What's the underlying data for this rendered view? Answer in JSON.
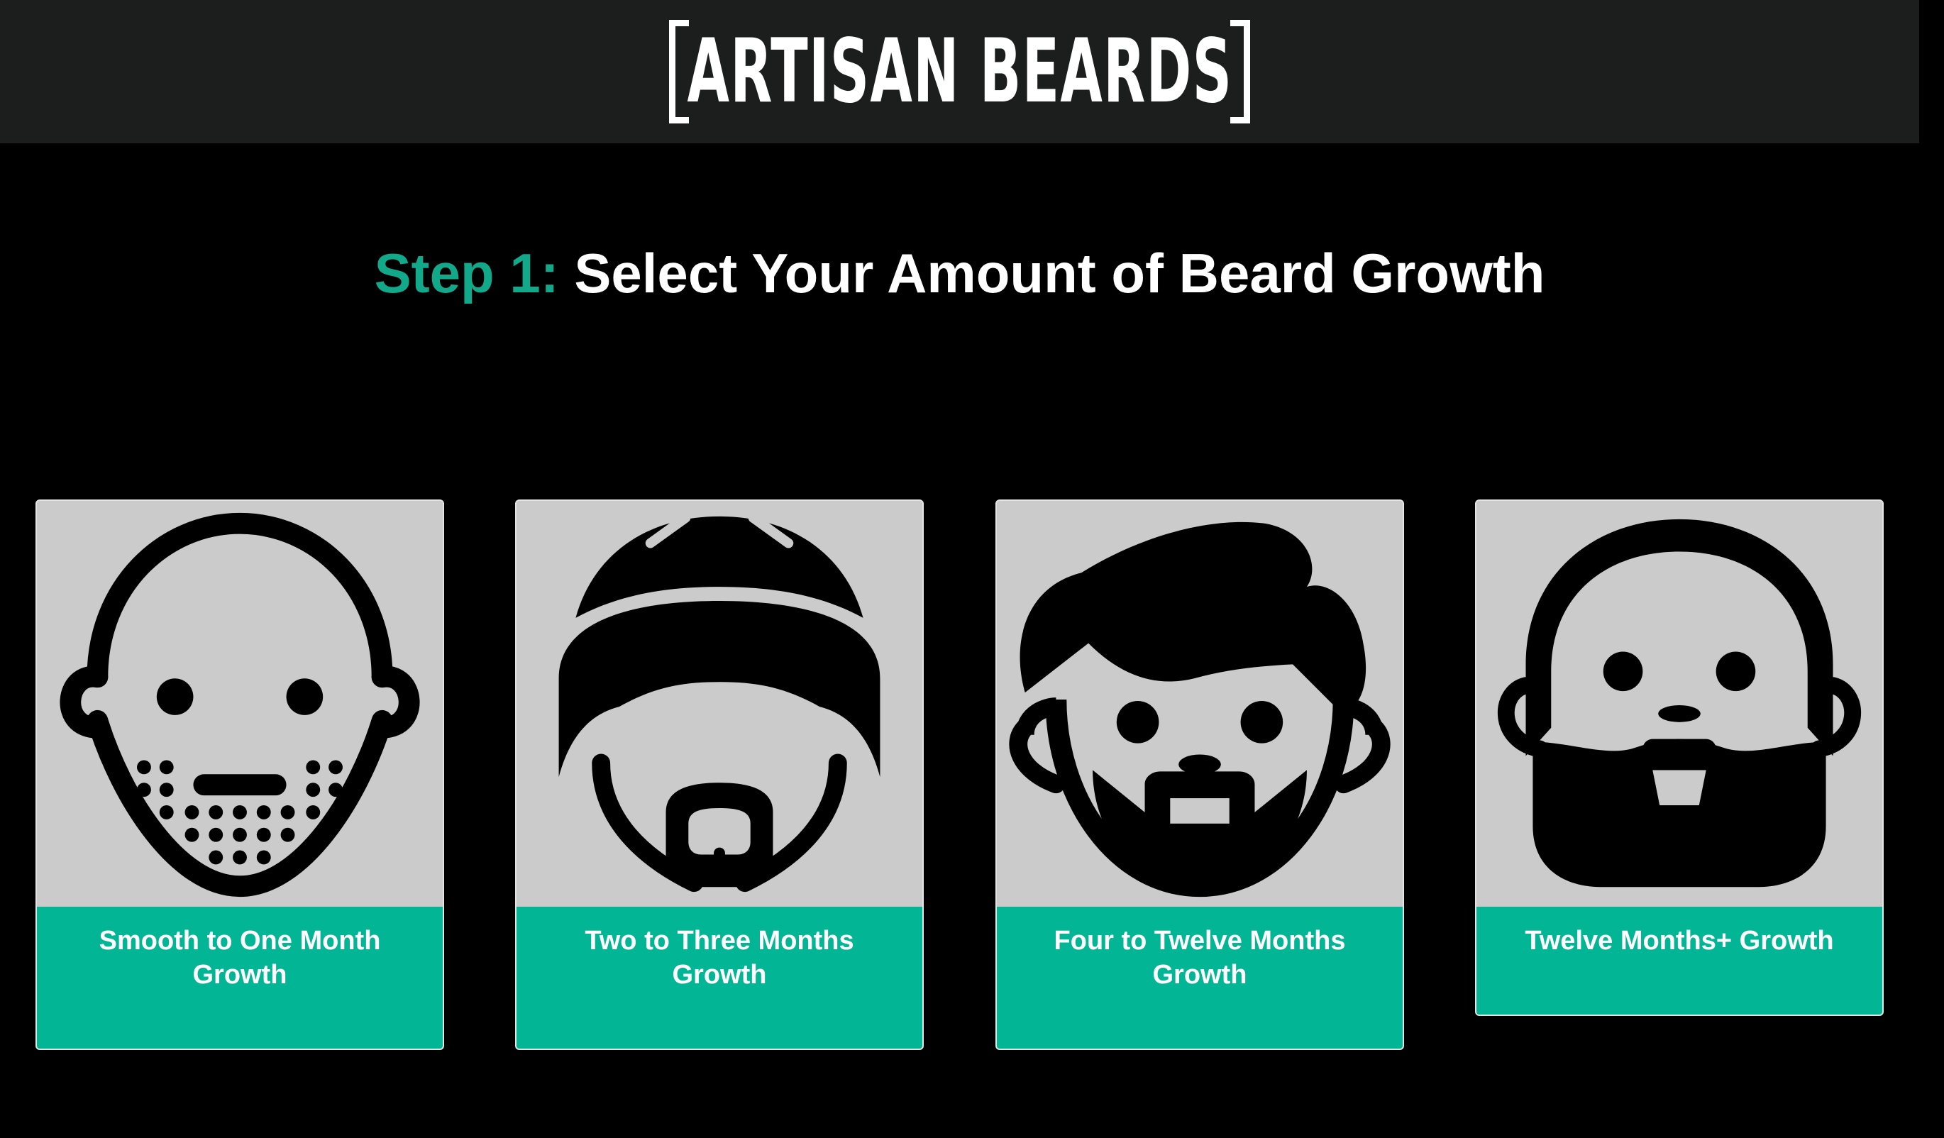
{
  "header": {
    "logo_text": "ARTISAN BEARDS"
  },
  "step": {
    "label": "Step 1:",
    "title": "Select Your Amount of Beard Growth"
  },
  "options": [
    {
      "label": "Smooth to One Month Growth",
      "icon": "stubble-face-icon"
    },
    {
      "label": "Two to Three Months Growth",
      "icon": "beanie-goatee-face-icon"
    },
    {
      "label": "Four to Twelve Months Growth",
      "icon": "short-beard-face-icon"
    },
    {
      "label": "Twelve Months+ Growth",
      "icon": "full-beard-face-icon"
    }
  ],
  "colors": {
    "accent": "#02b594",
    "step_label": "#12a88a",
    "header_bg": "#1c1d1d",
    "page_bg": "#000000",
    "card_bg": "#cbcbcb"
  }
}
